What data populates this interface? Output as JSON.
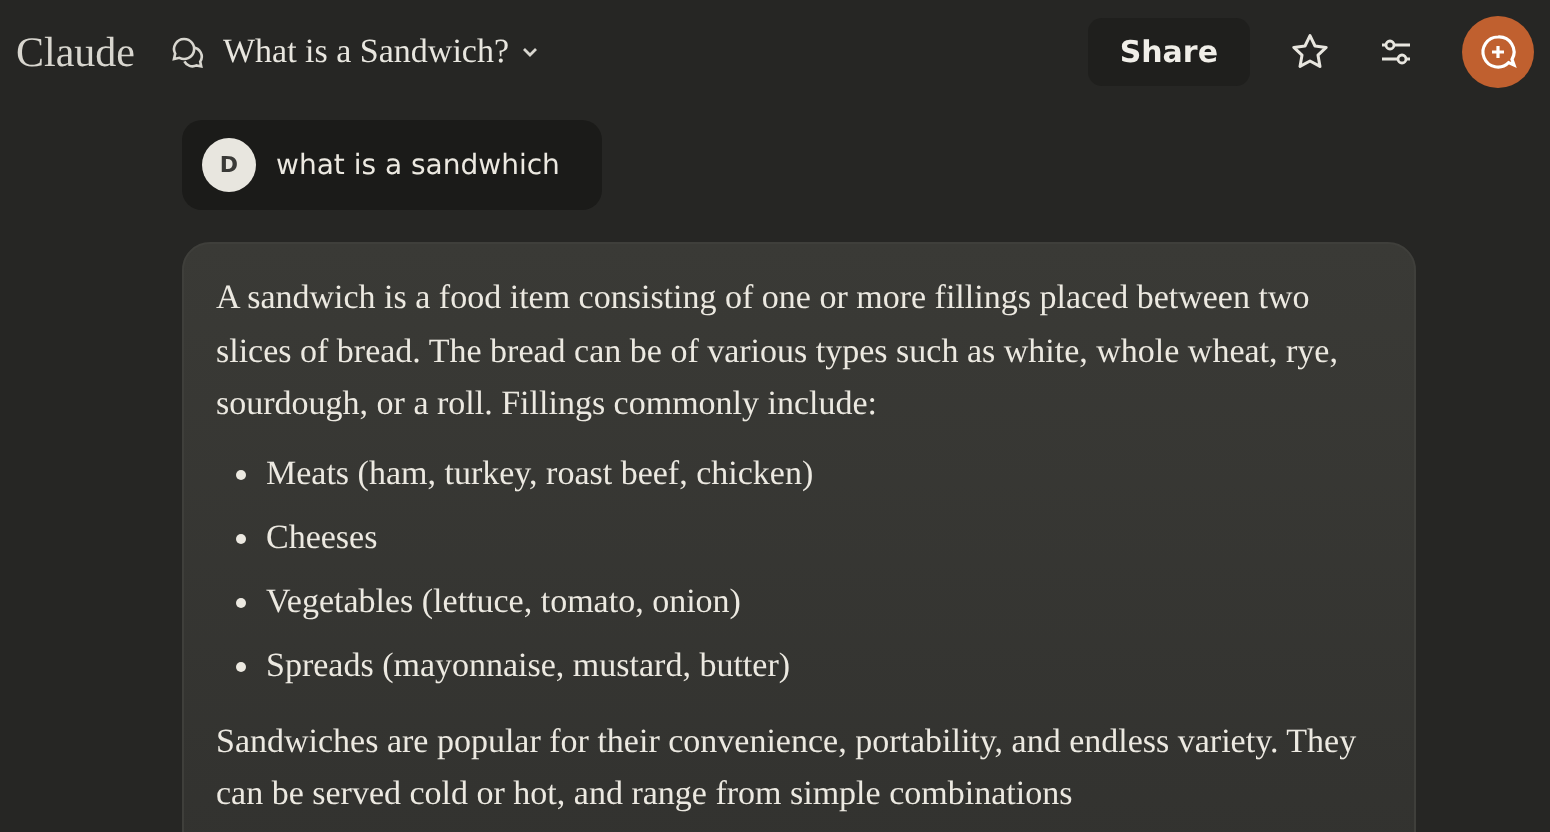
{
  "header": {
    "logo": "Claude",
    "chat_title": "What is a Sandwich?",
    "share_button": "Share"
  },
  "user_message": {
    "avatar_initial": "D",
    "text": "what is a sandwhich"
  },
  "assistant_message": {
    "intro": "A sandwich is a food item consisting of one or more fillings placed between two slices of bread. The bread can be of various types such as white, whole wheat, rye, sourdough, or a roll. Fillings commonly include:",
    "bullets": [
      "Meats (ham, turkey, roast beef, chicken)",
      "Cheeses",
      "Vegetables (lettuce, tomato, onion)",
      "Spreads (mayonnaise, mustard, butter)"
    ],
    "outro": "Sandwiches are popular for their convenience, portability, and endless variety. They can be served cold or hot, and range from simple combinations"
  }
}
